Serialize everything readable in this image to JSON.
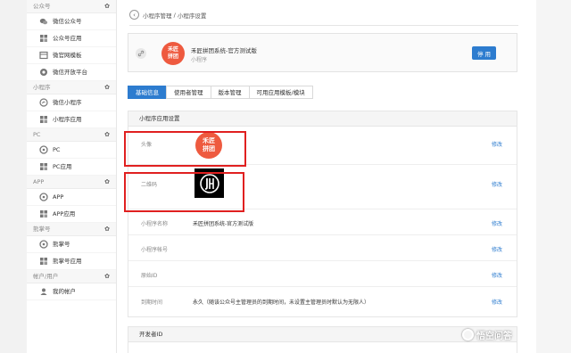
{
  "sidebar": {
    "sections": [
      {
        "title": "公众号",
        "items": [
          {
            "label": "微信公众号",
            "icon": "wechat-icon"
          },
          {
            "label": "公众号应用",
            "icon": "app-icon"
          },
          {
            "label": "微官网模板",
            "icon": "template-icon"
          },
          {
            "label": "微信开放平台",
            "icon": "platform-icon"
          }
        ]
      },
      {
        "title": "小程序",
        "items": [
          {
            "label": "微信小程序",
            "icon": "miniprogram-icon"
          },
          {
            "label": "小程序应用",
            "icon": "app-icon"
          }
        ]
      },
      {
        "title": "PC",
        "items": [
          {
            "label": "PC",
            "icon": "pc-icon"
          },
          {
            "label": "PC应用",
            "icon": "app-icon"
          }
        ]
      },
      {
        "title": "APP",
        "items": [
          {
            "label": "APP",
            "icon": "mobile-icon"
          },
          {
            "label": "APP应用",
            "icon": "app-icon"
          }
        ]
      },
      {
        "title": "熊掌号",
        "items": [
          {
            "label": "熊掌号",
            "icon": "paw-icon"
          },
          {
            "label": "熊掌号应用",
            "icon": "app-icon"
          }
        ]
      },
      {
        "title": "帐户/用户",
        "items": [
          {
            "label": "我的帐户",
            "icon": "user-icon"
          }
        ]
      }
    ]
  },
  "breadcrumb": {
    "parent": "小程序管理",
    "separator": "/",
    "current": "小程序设置"
  },
  "app": {
    "name": "禾匠拼团系统-官方测试版",
    "type": "小程序",
    "logo_text": [
      "禾匠",
      "拼团"
    ],
    "disable_label": "停 用"
  },
  "tabs": [
    "基础信息",
    "使用者管理",
    "版本管理",
    "可用应用模板/模块"
  ],
  "settings": {
    "title": "小程序应用设置",
    "rows": [
      {
        "label": "头像",
        "value": "",
        "action": "修改"
      },
      {
        "label": "二维码",
        "value": "",
        "action": "修改"
      },
      {
        "label": "小程序名称",
        "value": "禾匠拼团系统-官方测试版",
        "action": "修改"
      },
      {
        "label": "小程序帐号",
        "value": "",
        "action": "修改"
      },
      {
        "label": "原始ID",
        "value": "",
        "action": "修改"
      },
      {
        "label": "到期时间",
        "value": "永久（随该公众号主管理员的到期时间，未设置主管理员时默认为无限人）",
        "action": "修改"
      }
    ]
  },
  "developer": {
    "title": "开发者ID"
  },
  "watermark": {
    "text": "悟空问答"
  },
  "colors": {
    "primary": "#2d7ccf",
    "logo": "#ee5a3f",
    "highlight": "#e02020"
  }
}
